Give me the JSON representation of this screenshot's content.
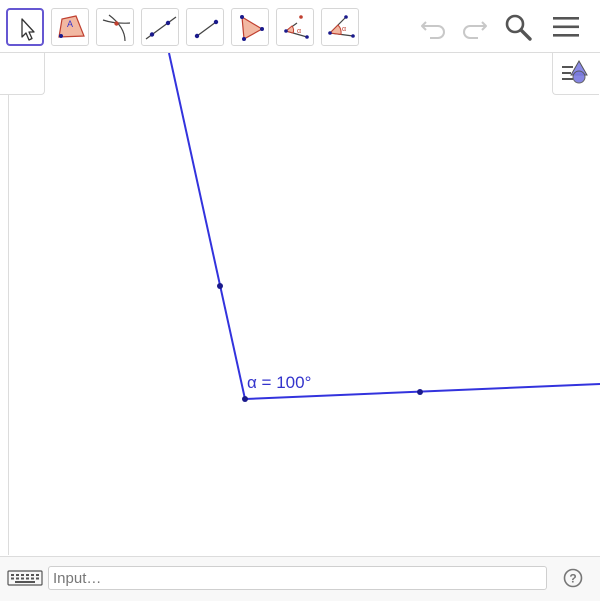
{
  "toolbar": {
    "tools": [
      {
        "name": "Move",
        "icon": "move-arrow-icon",
        "selected": true
      },
      {
        "name": "Polygon",
        "icon": "polygon-icon"
      },
      {
        "name": "Intersect",
        "icon": "intersect-icon"
      },
      {
        "name": "Line",
        "icon": "line-icon"
      },
      {
        "name": "Segment",
        "icon": "segment-icon"
      },
      {
        "name": "Triangle",
        "icon": "triangle-icon"
      },
      {
        "name": "Angle",
        "icon": "angle-icon"
      },
      {
        "name": "Angle with Given Size",
        "icon": "angle-given-size-icon"
      }
    ],
    "actions": [
      "undo-icon",
      "redo-icon",
      "search-icon",
      "menu-icon"
    ],
    "colors": {
      "selected_border": "#6557d2",
      "point": "#1a1a8c",
      "polygon_fill": "#f2b8a2",
      "polygon_stroke": "#c04030",
      "icon_gray": "#555555"
    }
  },
  "graphics": {
    "line_color": "#3333dd",
    "point_color": "#1a1a8c",
    "angle_label": "α = 100°"
  },
  "input_bar": {
    "placeholder": "Input…"
  }
}
